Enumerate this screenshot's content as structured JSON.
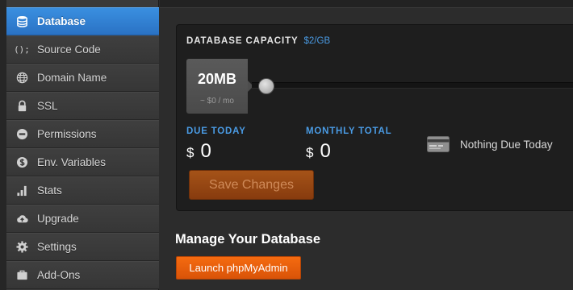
{
  "sidebar": {
    "items": [
      {
        "label": "Database",
        "icon": "database-icon",
        "active": true
      },
      {
        "label": "Source Code",
        "icon": "code-icon",
        "active": false
      },
      {
        "label": "Domain Name",
        "icon": "globe-icon",
        "active": false
      },
      {
        "label": "SSL",
        "icon": "lock-icon",
        "active": false
      },
      {
        "label": "Permissions",
        "icon": "minus-circle-icon",
        "active": false
      },
      {
        "label": "Env. Variables",
        "icon": "dollar-circle-icon",
        "active": false
      },
      {
        "label": "Stats",
        "icon": "bar-chart-icon",
        "active": false
      },
      {
        "label": "Upgrade",
        "icon": "cloud-upload-icon",
        "active": false
      },
      {
        "label": "Settings",
        "icon": "gear-icon",
        "active": false
      },
      {
        "label": "Add-Ons",
        "icon": "briefcase-icon",
        "active": false
      }
    ],
    "code_glyph": "();"
  },
  "capacity": {
    "title": "DATABASE CAPACITY",
    "price_per_gb": "$2/GB",
    "value": "20MB",
    "monthly_price": "~ $0 / mo",
    "slider_level": 0.0
  },
  "billing": {
    "due_today_label": "DUE TODAY",
    "due_today_currency": "$",
    "due_today_value": "0",
    "monthly_total_label": "MONTHLY TOTAL",
    "monthly_total_currency": "$",
    "monthly_total_value": "0",
    "due_note": "Nothing Due Today"
  },
  "actions": {
    "save_label": "Save Changes",
    "manage_title": "Manage Your Database",
    "launch_label": "Launch phpMyAdmin"
  },
  "colors": {
    "active_blue": "#2f80d6",
    "accent_blue": "#4a9be4",
    "save_orange": "#a55318",
    "launch_orange": "#f56b10"
  }
}
